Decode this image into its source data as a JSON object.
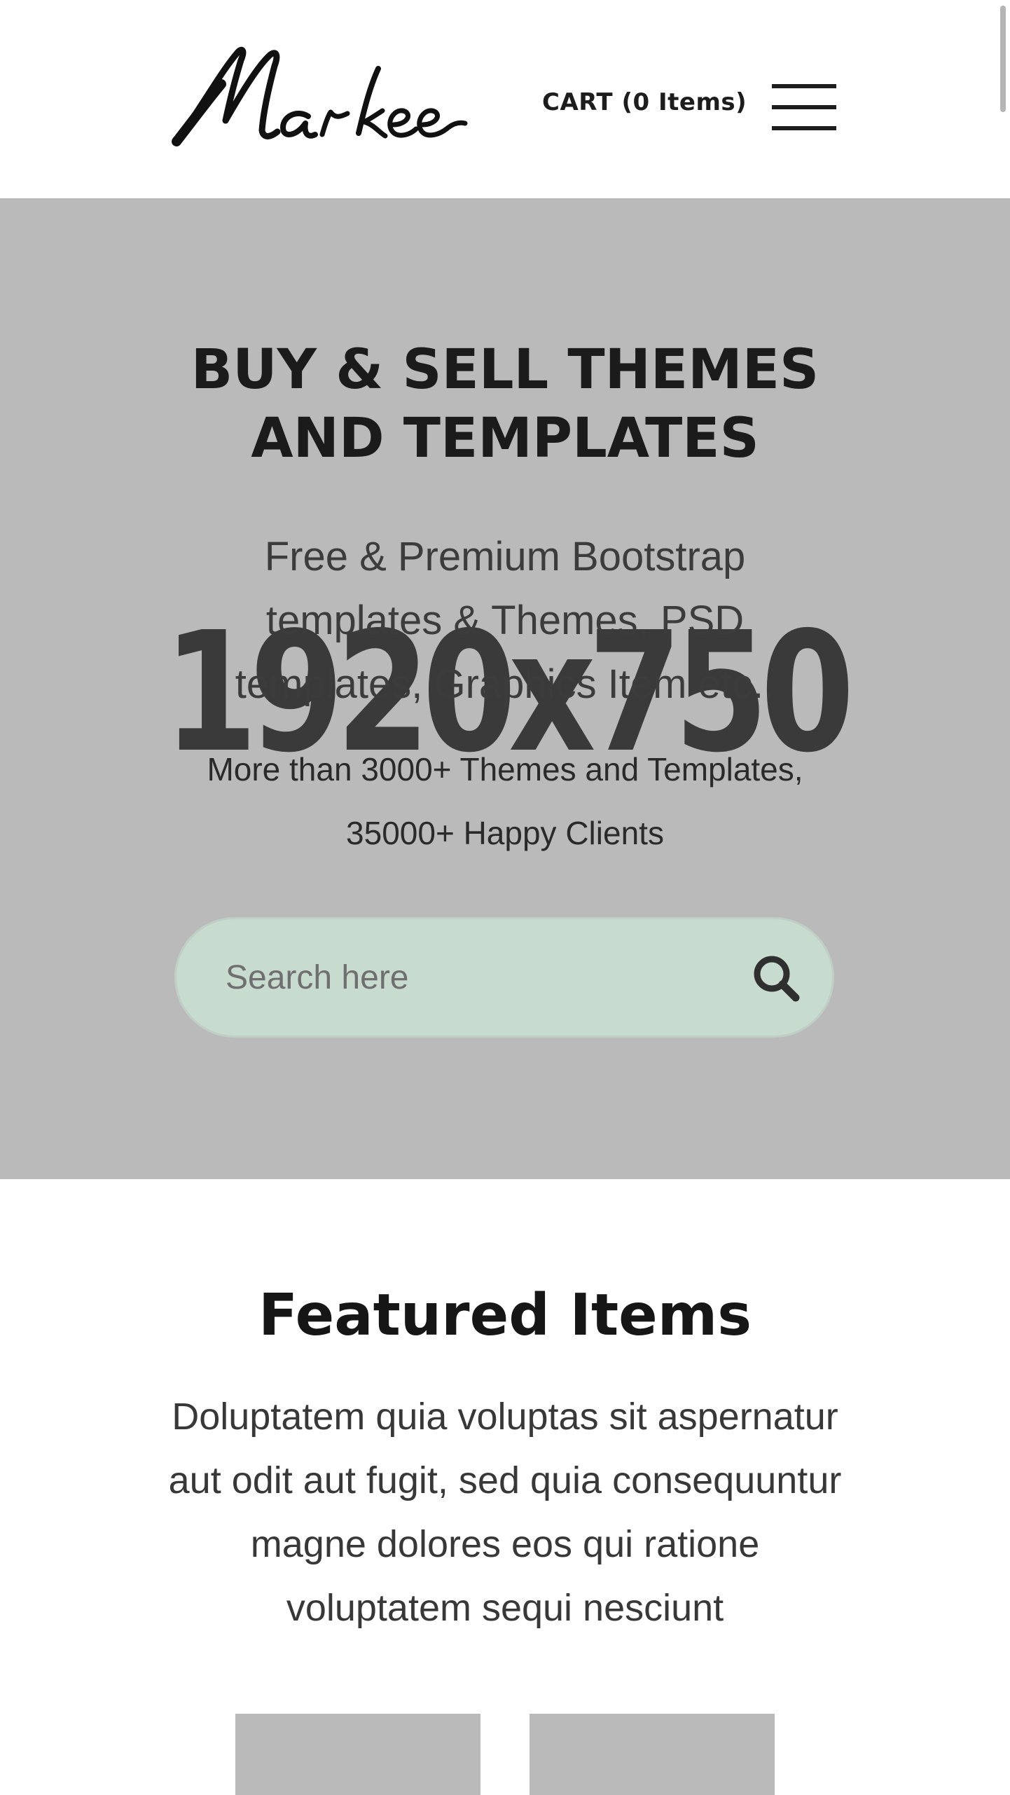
{
  "header": {
    "logo_text": "Markee",
    "cart_label": "CART (0 Items)",
    "menu_icon": "hamburger-menu-icon"
  },
  "hero": {
    "placeholder_label": "1920x750",
    "title": "BUY & SELL THEMES AND TEMPLATES",
    "subtitle": "Free & Premium Bootstrap templates & Themes, PSD templates, Graphics Item etc..",
    "stats": "More than 3000+ Themes and Templates, 35000+ Happy Clients",
    "search": {
      "placeholder": "Search here",
      "icon": "search-icon"
    }
  },
  "featured": {
    "title": "Featured Items",
    "description": "Doluptatem quia voluptas sit aspernatur aut odit aut fugit, sed quia consequuntur magne dolores eos qui ratione voluptatem sequi nesciunt"
  },
  "colors": {
    "hero_background": "#bababa",
    "search_background": "#c8dbcf",
    "text_dark": "#1b1b1b"
  }
}
